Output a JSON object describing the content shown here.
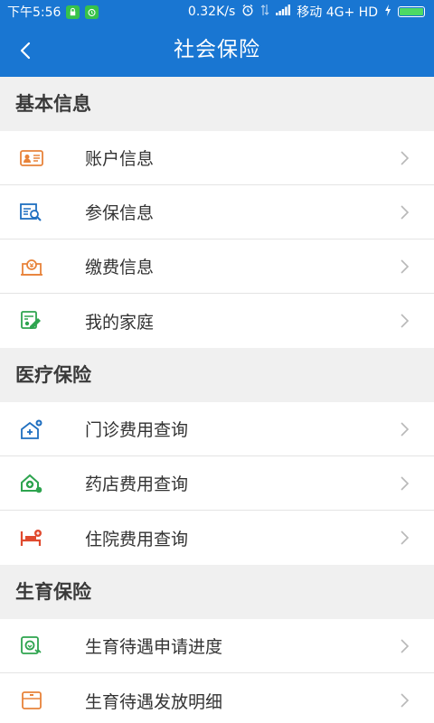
{
  "status_bar": {
    "time": "下午5:56",
    "net_speed": "0.32K/s",
    "carrier": "移动 4G+ HD"
  },
  "nav": {
    "title": "社会保险",
    "back_icon": "chevron-left-icon"
  },
  "sections": [
    {
      "title": "基本信息",
      "items": [
        {
          "label": "账户信息",
          "icon": "id-card-icon"
        },
        {
          "label": "参保信息",
          "icon": "document-search-icon"
        },
        {
          "label": "缴费信息",
          "icon": "payment-icon"
        },
        {
          "label": "我的家庭",
          "icon": "family-icon"
        }
      ]
    },
    {
      "title": "医疗保险",
      "items": [
        {
          "label": "门诊费用查询",
          "icon": "clinic-icon"
        },
        {
          "label": "药店费用查询",
          "icon": "pharmacy-icon"
        },
        {
          "label": "住院费用查询",
          "icon": "hospital-bed-icon"
        }
      ]
    },
    {
      "title": "生育保险",
      "items": [
        {
          "label": "生育待遇申请进度",
          "icon": "maternity-progress-icon"
        },
        {
          "label": "生育待遇发放明细",
          "icon": "maternity-detail-icon"
        }
      ]
    }
  ],
  "colors": {
    "primary": "#1976d2",
    "orange": "#e8833a",
    "blue_icon": "#1f6fc0",
    "green_icon": "#2ea44f",
    "red_icon": "#e04a2f"
  }
}
